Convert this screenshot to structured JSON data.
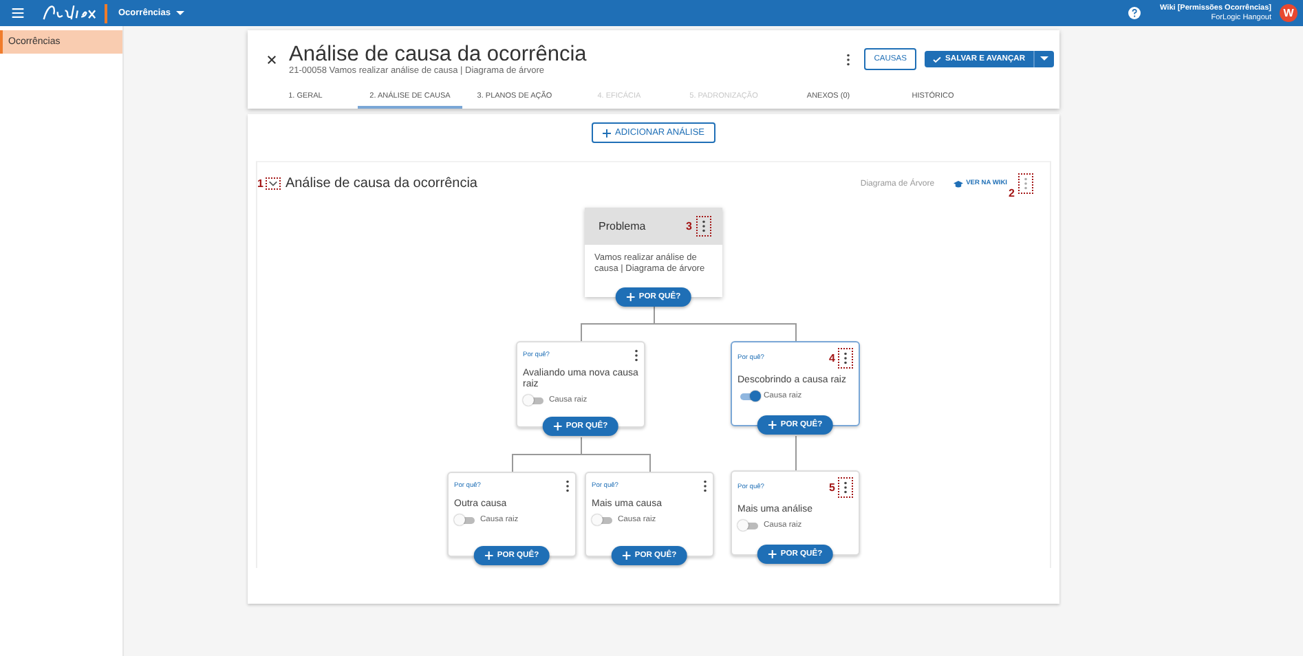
{
  "topbar": {
    "module": "Ocorrências",
    "user_name": "Wiki [Permissões Ocorrências]",
    "user_org": "ForLogic Hangout",
    "avatar": "W"
  },
  "sidebar": {
    "items": [
      {
        "label": "Ocorrências",
        "selected": true
      }
    ]
  },
  "header": {
    "title": "Análise de causa da ocorrência",
    "subtitle": "21-00058 Vamos realizar análise de causa | Diagrama de árvore",
    "causes_button": "CAUSAS",
    "save_button": "SALVAR E AVANÇAR"
  },
  "tabs": [
    {
      "label": "1. GERAL",
      "selected": false,
      "disabled": false
    },
    {
      "label": "2. ANÁLISE DE CAUSA",
      "selected": true,
      "disabled": false
    },
    {
      "label": "3. PLANOS DE AÇÃO",
      "selected": false,
      "disabled": false
    },
    {
      "label": "4. EFICÁCIA",
      "selected": false,
      "disabled": true
    },
    {
      "label": "5. PADRONIZAÇÃO",
      "selected": false,
      "disabled": true
    },
    {
      "label": "ANEXOS (0)",
      "selected": false,
      "disabled": false
    },
    {
      "label": "HISTÓRICO",
      "selected": false,
      "disabled": false
    }
  ],
  "add_button": "ADICIONAR ANÁLISE",
  "section": {
    "marker": "1",
    "title": "Análise de causa da ocorrência",
    "method": "Diagrama de Árvore",
    "wiki_link": "VER NA WIKI",
    "menu_marker": "2"
  },
  "tree": {
    "title": "Problema",
    "marker": "3",
    "text": "Vamos realizar análise de causa | Diagrama de árvore",
    "button": "POR QUÊ?",
    "children": [
      {
        "label": "Por quê?",
        "title": "Avaliando uma nova causa raiz",
        "root_cause": false,
        "toggle_label": "Causa raiz",
        "button": "POR QUÊ?",
        "children": [
          {
            "label": "Por quê?",
            "title": "Outra causa",
            "root_cause": false,
            "toggle_label": "Causa raiz",
            "button": "POR QUÊ?"
          },
          {
            "label": "Por quê?",
            "title": "Mais uma causa",
            "root_cause": false,
            "toggle_label": "Causa raiz",
            "button": "POR QUÊ?"
          }
        ]
      },
      {
        "label": "Por quê?",
        "title": "Descobrindo a causa raiz",
        "marker": "4",
        "root_cause": true,
        "toggle_label": "Causa raiz",
        "button": "POR QUÊ?",
        "children": [
          {
            "label": "Por quê?",
            "title": "Mais uma análise",
            "marker": "5",
            "root_cause": false,
            "toggle_label": "Causa raiz",
            "button": "POR QUÊ?"
          }
        ]
      }
    ]
  }
}
